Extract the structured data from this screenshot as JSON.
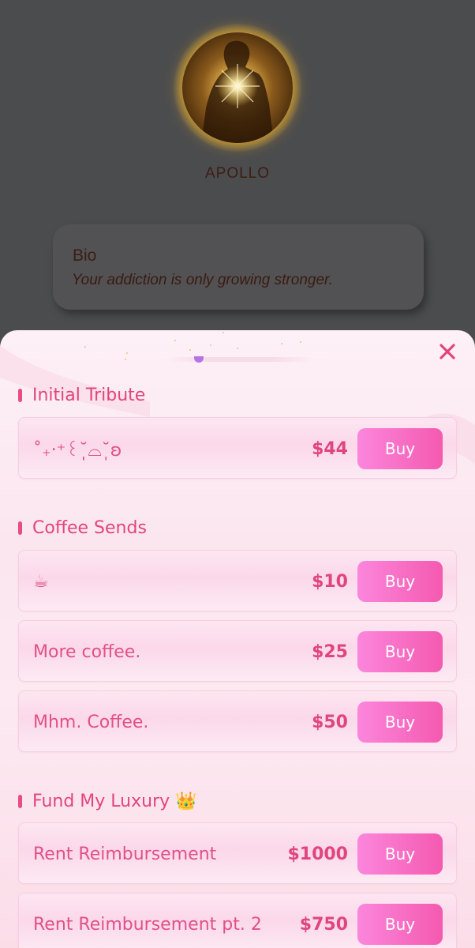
{
  "profile": {
    "name": "APOLLO",
    "bio_title": "Bio",
    "bio_text": "Your addiction is only growing stronger."
  },
  "sheet": {
    "close_icon": "close-icon",
    "sections": [
      {
        "title": "Initial Tribute",
        "items": [
          {
            "name": "˚₊‧⁺꒰˘̩̩̩⌓˘̩̩̩ʚ",
            "price": "$44",
            "buy": "Buy"
          }
        ]
      },
      {
        "title": "Coffee Sends",
        "items": [
          {
            "name": "☕",
            "price": "$10",
            "buy": "Buy"
          },
          {
            "name": "More coffee.",
            "price": "$25",
            "buy": "Buy"
          },
          {
            "name": "Mhm. Coffee.",
            "price": "$50",
            "buy": "Buy"
          }
        ]
      },
      {
        "title": "Fund My Luxury 👑",
        "items": [
          {
            "name": "Rent Reimbursement",
            "price": "$1000",
            "buy": "Buy"
          },
          {
            "name": "Rent Reimbursement pt. 2",
            "price": "$750",
            "buy": "Buy"
          }
        ]
      }
    ]
  },
  "colors": {
    "accent": "#e2457c",
    "buy_gradient_start": "#fb86dc",
    "buy_gradient_end": "#f45ab0",
    "overlay": "#4b4c4e"
  }
}
